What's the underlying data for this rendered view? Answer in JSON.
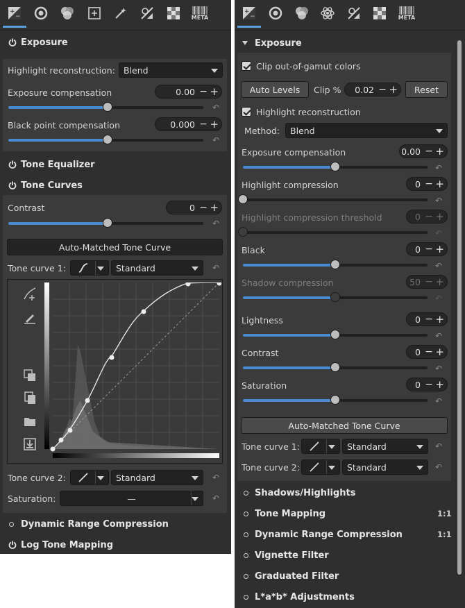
{
  "left": {
    "toolbar": {
      "meta_label": "META"
    },
    "exposure": {
      "title": "Exposure",
      "highlight_label": "Highlight reconstruction:",
      "highlight_value": "Blend",
      "exp_comp_label": "Exposure compensation",
      "exp_comp_value": "0.00",
      "exp_comp_level": 0.51,
      "black_label": "Black point compensation",
      "black_value": "0.000",
      "black_level": 0.51
    },
    "tone_equalizer": {
      "title": "Tone Equalizer"
    },
    "tone_curves": {
      "title": "Tone Curves",
      "contrast_label": "Contrast",
      "contrast_value": "0",
      "contrast_level": 0.51,
      "auto_matched_button": "Auto-Matched Tone Curve",
      "curve1_label": "Tone curve 1:",
      "curve1_value": "Standard",
      "curve2_label": "Tone curve 2:",
      "curve2_value": "Standard",
      "saturation_label": "Saturation:",
      "saturation_value": "—"
    },
    "dynamic_range": {
      "title": "Dynamic Range Compression"
    },
    "log_tone": {
      "title": "Log Tone Mapping"
    }
  },
  "right": {
    "toolbar": {
      "meta_label": "META"
    },
    "exposure": {
      "title": "Exposure",
      "clip_gamut_label": "Clip out-of-gamut colors",
      "auto_levels_button": "Auto Levels",
      "clip_pct_label": "Clip %",
      "clip_pct_value": "0.02",
      "reset_button": "Reset",
      "highlight_recon_label": "Highlight reconstruction",
      "method_label": "Method:",
      "method_value": "Blend",
      "sliders": [
        {
          "label": "Exposure compensation",
          "value": "0.00",
          "level": 0.5,
          "dim": false
        },
        {
          "label": "Highlight compression",
          "value": "0",
          "level": 0.0,
          "dim": false
        },
        {
          "label": "Highlight compression threshold",
          "value": "0",
          "level": 0.0,
          "dim": true
        },
        {
          "label": "Black",
          "value": "0",
          "level": 0.5,
          "dim": false
        },
        {
          "label": "Shadow compression",
          "value": "50",
          "level": 0.5,
          "dim": true
        },
        {
          "label": "Lightness",
          "value": "0",
          "level": 0.5,
          "dim": false
        },
        {
          "label": "Contrast",
          "value": "0",
          "level": 0.5,
          "dim": false
        },
        {
          "label": "Saturation",
          "value": "0",
          "level": 0.5,
          "dim": false
        }
      ],
      "auto_matched_button": "Auto-Matched Tone Curve",
      "curve1_label": "Tone curve 1:",
      "curve1_value": "Standard",
      "curve2_label": "Tone curve 2:",
      "curve2_value": "Standard"
    },
    "collapsed": [
      {
        "title": "Shadows/Highlights",
        "badge": ""
      },
      {
        "title": "Tone Mapping",
        "badge": "1:1"
      },
      {
        "title": "Dynamic Range Compression",
        "badge": "1:1"
      },
      {
        "title": "Vignette Filter",
        "badge": ""
      },
      {
        "title": "Graduated Filter",
        "badge": ""
      },
      {
        "title": "L*a*b* Adjustments",
        "badge": ""
      }
    ]
  }
}
